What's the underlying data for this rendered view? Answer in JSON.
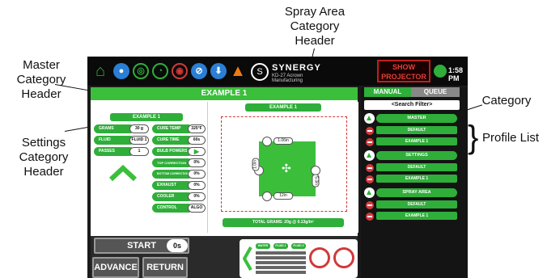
{
  "callouts": {
    "master": "Master Category Header",
    "settings": "Settings Category Header",
    "spray": "Spray Area Category Header",
    "category": "Category",
    "profile_list": "Profile List"
  },
  "topbar": {
    "logo_name": "SYNERGY",
    "logo_sub": "KD-27  Acrown Manufacturing",
    "show_projector": "SHOW PROJECTOR",
    "time": "1:58 PM",
    "icons": [
      "home-icon",
      "user-icon",
      "spray-gun-icon",
      "gauge-icon",
      "target-icon",
      "no-entry-icon",
      "download-icon",
      "warning-icon"
    ]
  },
  "master_header": "EXAMPLE 1",
  "settings": {
    "header": "EXAMPLE 1",
    "left": [
      {
        "label": "GRAMS",
        "value": "30 g"
      },
      {
        "label": "FLUID",
        "value": "FLUID 1"
      },
      {
        "label": "PASSES",
        "value": "1"
      }
    ],
    "right": [
      {
        "label": "CURE TEMP",
        "value": "325°F"
      },
      {
        "label": "CURE TIME",
        "value": "60s"
      },
      {
        "label": "BULB POWERS",
        "value": ""
      },
      {
        "label": "TOP CORRECTION",
        "value": "0%"
      },
      {
        "label": "BOTTOM CORRECTION",
        "value": "0%"
      },
      {
        "label": "EXHAUST",
        "value": "0%"
      },
      {
        "label": "COOLER",
        "value": "0%"
      },
      {
        "label": "CONTROL",
        "value": "ALGO"
      }
    ]
  },
  "spray_area": {
    "header": "EXAMPLE 1",
    "top_measure": "1.06in",
    "left_measure": "1.0in",
    "right_measure": "5.3in",
    "bottom_measure": "12in",
    "total": "TOTAL GRAMS: 20g @ 0.13g/in²"
  },
  "controls": {
    "start": "START",
    "timer": "0s",
    "advance": "ADVANCE",
    "return": "RETURN",
    "mini_labels": [
      "WATER",
      "FLUID 1",
      "FLUID 2"
    ]
  },
  "right_panel": {
    "tab_manual": "MANUAL",
    "tab_queue": "QUEUE",
    "search": "<Search Filter>",
    "categories": [
      {
        "name": "MASTER",
        "profiles": [
          "DEFAULT",
          "EXAMPLE 1"
        ]
      },
      {
        "name": "SETTINGS",
        "profiles": [
          "DEFAULT",
          "EXAMPLE 1"
        ]
      },
      {
        "name": "SPRAY AREA",
        "profiles": [
          "DEFAULT",
          "EXAMPLE 1"
        ]
      }
    ]
  },
  "colors": {
    "accent": "#2fae3a",
    "danger": "#d03a3a",
    "dark": "#1a1a1a"
  }
}
